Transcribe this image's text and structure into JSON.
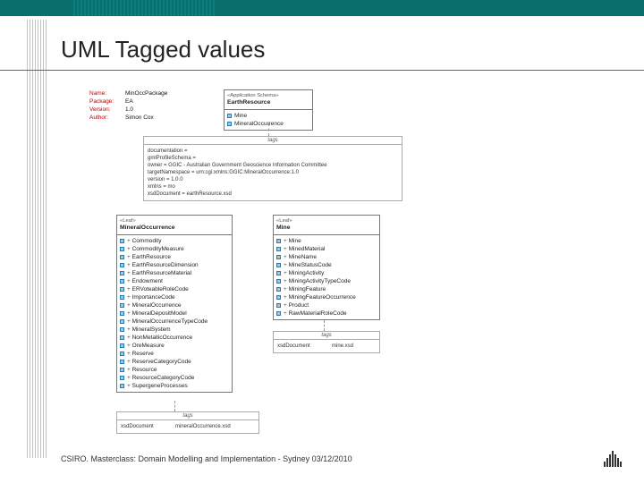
{
  "header": {
    "title": "UML Tagged values"
  },
  "footer": {
    "text": "CSIRO.  Masterclass: Domain Modelling and Implementation - Sydney 03/12/2010"
  },
  "kv": {
    "name_k": "Name:",
    "name_v": "MinOccPackage",
    "pkg_k": "Package:",
    "pkg_v": "EA",
    "ver_k": "Version:",
    "ver_v": "1.0",
    "auth_k": "Author:",
    "auth_v": "Simon Cox"
  },
  "packageBox": {
    "stereo": "«Application Schema»",
    "name": "EarthResource",
    "items": [
      "Mine",
      "MineralOccurrence"
    ]
  },
  "packageTags": {
    "title": "tags",
    "lines": [
      "documentation =",
      "gmlProfileSchema =",
      "owner = GGIC - Australian Government Geoscience Information Committee",
      "targetNamespace = urn:cgi:xmlns:GGIC:MineralOccurrence:1.0",
      "version = 1.0.0",
      "xmlns = mo",
      "xsdDocument = earthResource.xsd"
    ]
  },
  "mineralOccurrence": {
    "stereo": "«Leaf»",
    "name": "MineralOccurrence",
    "items": [
      "Commodity",
      "CommodityMeasure",
      "EarthResource",
      "EarthResourceDimension",
      "EarthResourceMaterial",
      "Endowment",
      "ERVoteableRoleCode",
      "ImportanceCode",
      "MineralOccurrence",
      "MineralDepositModel",
      "MineralOccurrenceTypeCode",
      "MineralSystem",
      "NonMetallicOccurrence",
      "OreMeasure",
      "Reserve",
      "ReserveCategoryCode",
      "Resource",
      "ResourceCategoryCode",
      "SupergeneProcesses"
    ]
  },
  "mine": {
    "stereo": "«Leaf»",
    "name": "Mine",
    "items": [
      "Mine",
      "MinedMaterial",
      "MineName",
      "MineStatusCode",
      "MiningActivity",
      "MiningActivityTypeCode",
      "MiningFeature",
      "MiningFeatureOccurrence",
      "Product",
      "RawMaterialRoleCode"
    ]
  },
  "mineTags": {
    "title": "tags",
    "key": "xsdDocument",
    "val": "mine.xsd"
  },
  "moTags": {
    "title": "tags",
    "key": "xsdDocument",
    "val": "mineralOccurrence.xsd"
  }
}
